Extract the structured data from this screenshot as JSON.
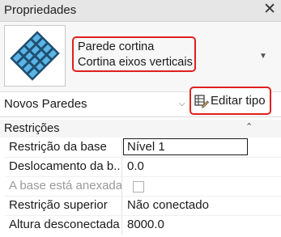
{
  "window": {
    "title": "Propriedades",
    "close_glyph": "✕"
  },
  "type_selector": {
    "thumbnail_icon": "curtain-wall-grid-icon",
    "family": "Parede cortina",
    "type": "Cortina eixos verticais",
    "arrow_glyph": "▼",
    "highlight_color": "#e0201e"
  },
  "instance_filter": {
    "label": "Novos Paredes",
    "arrow_glyph": "⌵"
  },
  "edit_type_button": {
    "label": "Editar tipo",
    "icon": "edit-type-icon"
  },
  "properties": {
    "section_title": "Restrições",
    "collapse_glyph": "⌃",
    "rows": [
      {
        "name": "Restrição da base",
        "value": "Nível 1"
      },
      {
        "name": "Deslocamento da b...",
        "value": "0.0"
      },
      {
        "name": "A base está anexada",
        "value": ""
      },
      {
        "name": "Restrição superior",
        "value": "Não conectado"
      },
      {
        "name": "Altura desconectada",
        "value": "8000.0"
      }
    ]
  }
}
